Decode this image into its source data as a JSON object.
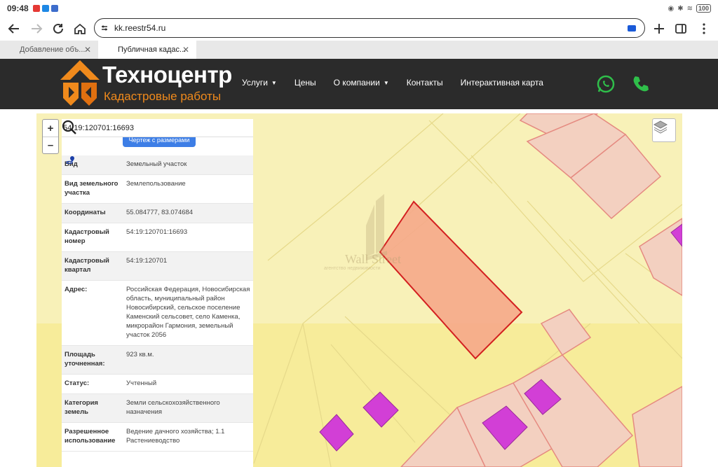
{
  "status": {
    "time": "09:48",
    "battery": "100"
  },
  "browser": {
    "url": "kk.reestr54.ru",
    "tabs": [
      {
        "label": "Добавление объ..."
      },
      {
        "label": "Публичная кадас..."
      }
    ]
  },
  "site": {
    "brand_title": "Техноцентр",
    "brand_subtitle": "Кадастровые работы",
    "nav": [
      {
        "label": "Услуги"
      },
      {
        "label": "Цены"
      },
      {
        "label": "О компании"
      },
      {
        "label": "Контакты"
      },
      {
        "label": "Интерактивная карта"
      }
    ]
  },
  "map": {
    "search_value": "54:19:120701:16693",
    "zoom_in": "+",
    "zoom_out": "–",
    "button_label": "Чертеж с размерами",
    "watermark": "Wall Street",
    "watermark_sub": "агентство недвижимости",
    "rows": [
      {
        "label": "Вид",
        "value": "Земельный участок"
      },
      {
        "label": "Вид земельного участка",
        "value": "Землепользование"
      },
      {
        "label": "Координаты",
        "value": "55.084777, 83.074684"
      },
      {
        "label": "Кадастровый номер",
        "value": "54:19:120701:16693"
      },
      {
        "label": "Кадастровый квартал",
        "value": "54:19:120701"
      },
      {
        "label": "Адрес:",
        "value": "Российская Федерация, Новосибирская область, муниципальный район Новосибирский, сельское поселение Каменский сельсовет, село Каменка, микрорайон Гармония, земельный участок 2056"
      },
      {
        "label": "Площадь уточненная:",
        "value": "923 кв.м."
      },
      {
        "label": "Статус:",
        "value": "Учтенный"
      },
      {
        "label": "Категория земель",
        "value": "Земли сельскохозяйственного назначения"
      },
      {
        "label": "Разрешенное использование",
        "value": "Ведение дачного хозяйства; 1.1 Растениеводство"
      }
    ]
  },
  "colors": {
    "header_bg": "#2b2b2b",
    "brand_orange": "#f08a1c",
    "map_bg": "#f8f1b8",
    "parcel_highlight": "#f5a98a",
    "building": "#d23fd6"
  }
}
